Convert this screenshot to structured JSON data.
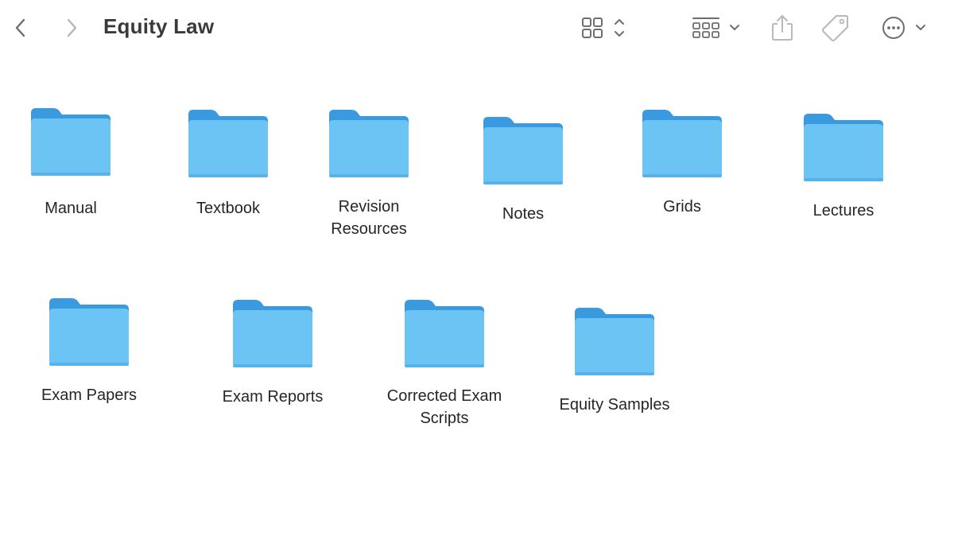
{
  "window": {
    "title": "Equity Law"
  },
  "toolbar": {
    "back": {
      "icon": "chevron-left-icon"
    },
    "forward": {
      "icon": "chevron-right-icon"
    },
    "view_mode": {
      "icon": "grid-view-icon"
    },
    "group": {
      "icon": "group-by-icon"
    },
    "share": {
      "icon": "share-icon"
    },
    "tag": {
      "icon": "tag-icon"
    },
    "more": {
      "icon": "ellipsis-circle-icon"
    }
  },
  "colors": {
    "folder_front": "#6CC4F5",
    "folder_back": "#3A9AE0",
    "icon_gray": "#7a7a7a",
    "icon_light": "#b8b8b8"
  },
  "folders": [
    {
      "label": "Manual"
    },
    {
      "label": "Textbook"
    },
    {
      "label": "Revision\nResources"
    },
    {
      "label": "Notes"
    },
    {
      "label": "Grids"
    },
    {
      "label": "Lectures"
    },
    {
      "label": "Exam Papers"
    },
    {
      "label": "Exam Reports"
    },
    {
      "label": "Corrected Exam\nScripts"
    },
    {
      "label": "Equity Samples"
    }
  ]
}
